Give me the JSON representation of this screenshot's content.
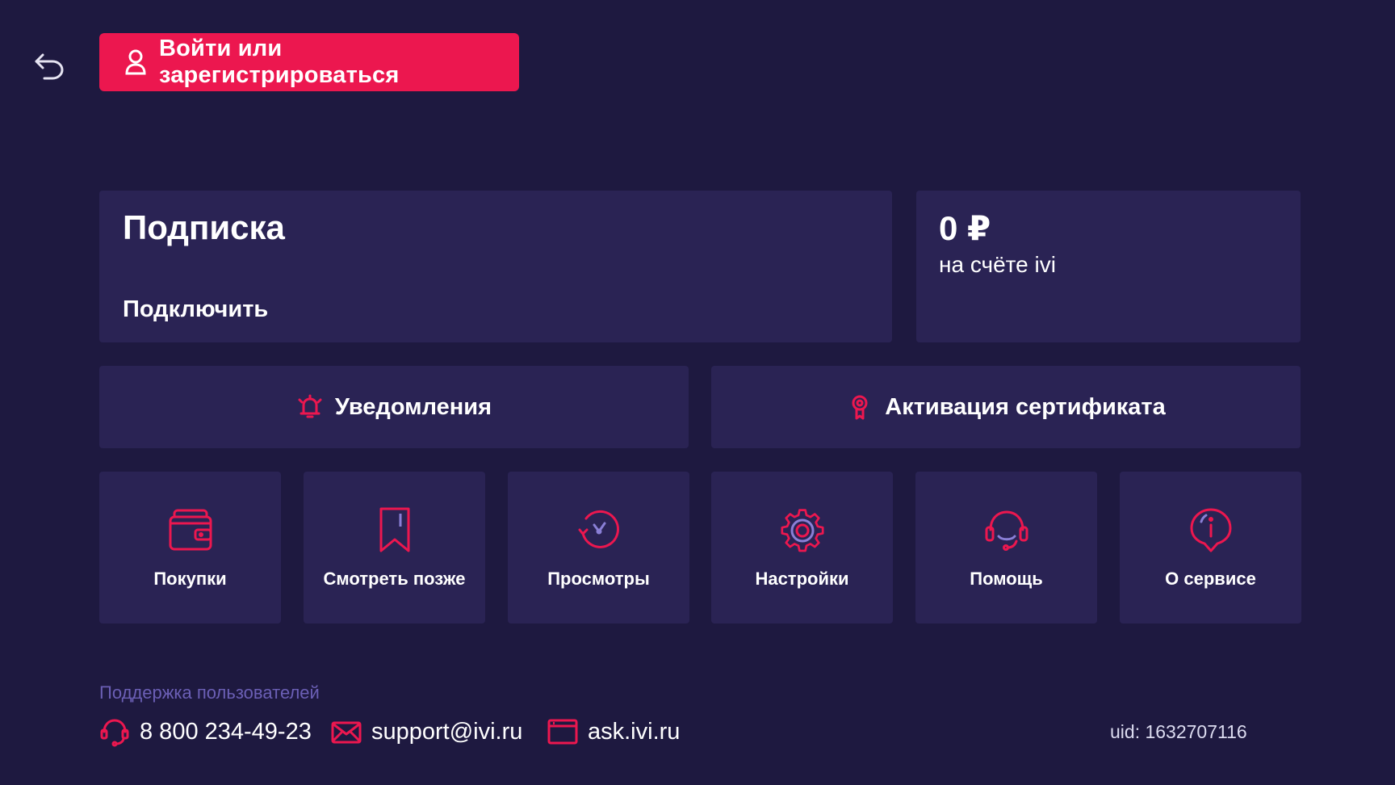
{
  "header": {
    "back_icon": "back-arrow-icon",
    "login_label": "Войти или зарегистрироваться",
    "login_icon": "user-icon"
  },
  "subscription": {
    "title": "Подписка",
    "action": "Подключить"
  },
  "balance": {
    "amount": "0 ₽",
    "label": "на счёте ivi"
  },
  "wide_actions": [
    {
      "label": "Уведомления",
      "icon": "bell-icon"
    },
    {
      "label": "Активация сертификата",
      "icon": "award-icon"
    }
  ],
  "tiles": [
    {
      "label": "Покупки",
      "icon": "wallet-icon"
    },
    {
      "label": "Смотреть позже",
      "icon": "bookmark-icon"
    },
    {
      "label": "Просмотры",
      "icon": "history-icon"
    },
    {
      "label": "Настройки",
      "icon": "gear-icon"
    },
    {
      "label": "Помощь",
      "icon": "headset-icon"
    },
    {
      "label": "О сервисе",
      "icon": "info-icon"
    }
  ],
  "footer": {
    "support_heading": "Поддержка пользователей",
    "phone": "8 800 234-49-23",
    "email": "support@ivi.ru",
    "site": "ask.ivi.ru",
    "uid": "uid: 1632707116"
  },
  "colors": {
    "background": "#1e1940",
    "card": "#2a2354",
    "accent": "#ec174f",
    "muted_text": "#6b5fb5"
  }
}
